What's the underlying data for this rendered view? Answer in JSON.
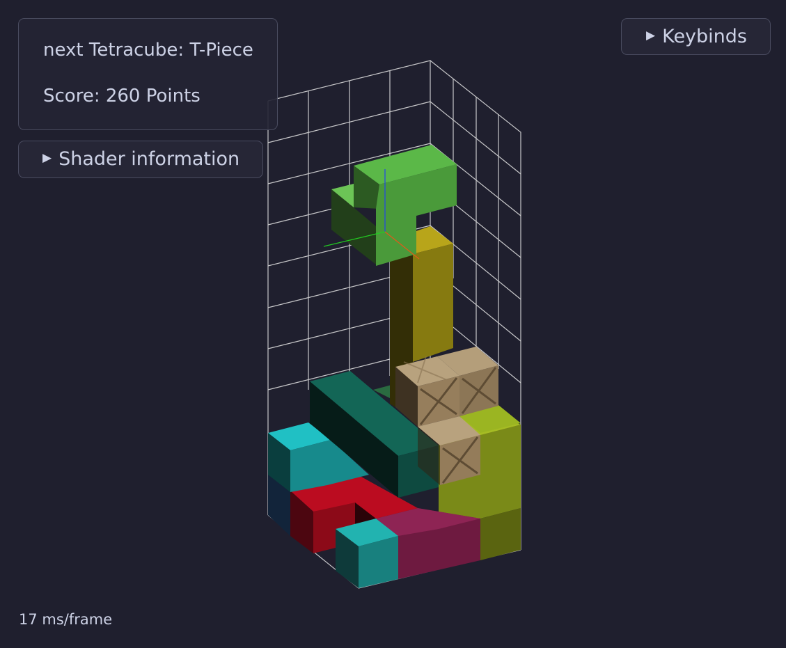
{
  "hud": {
    "next_piece_label": "next Tetracube: T-Piece",
    "score_label": "Score: 260 Points"
  },
  "toggles": {
    "shader_label": "Shader information",
    "keybinds_label": "Keybinds",
    "arrow_glyph": "▶"
  },
  "footer": {
    "frame_time": "17 ms/frame"
  },
  "colors": {
    "background": "#1f1f2e",
    "grid_lines": "#e6e6e6",
    "active_piece": "#5bb848",
    "yellow_piece": "#b8a51a",
    "teal_piece": "#136656",
    "cyan_piece": "#1fb6bb",
    "red_piece": "#bb0c20",
    "magenta_piece": "#8e2454",
    "lime_piece": "#9bb522",
    "crate": "#9a8462",
    "axis_x": "#e05a1a",
    "axis_y": "#22cc22",
    "axis_z": "#2244ee"
  }
}
